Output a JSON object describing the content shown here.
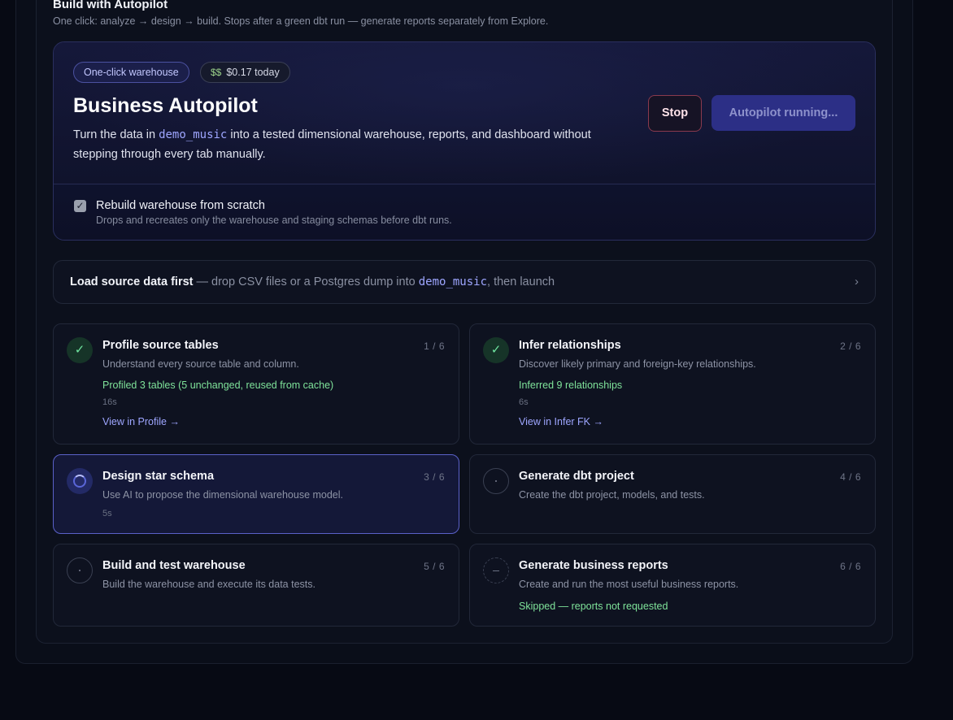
{
  "section": {
    "title": "Build with Autopilot",
    "subtitle": "One click: analyze → design → build. Stops after a green dbt run — generate reports separately from Explore."
  },
  "hero": {
    "mode_pill": "One-click warehouse",
    "cost_icon": "money-icon",
    "cost_pill": "$0.17 today",
    "title": "Business Autopilot",
    "desc_before": "Turn the data in ",
    "desc_code": "demo_music",
    "desc_after": " into a tested dimensional warehouse, reports, and dashboard without stepping through every tab manually.",
    "stop_label": "Stop",
    "run_label": "Autopilot running...",
    "rebuild": {
      "checked": true,
      "label": "Rebuild warehouse from scratch",
      "sub": "Drops and recreates only the warehouse and staging schemas before dbt runs."
    }
  },
  "load": {
    "strong": "Load source data first",
    "before": " — drop CSV files or a Postgres dump into ",
    "code": "demo_music",
    "after": ", then launch",
    "chevron": "›"
  },
  "steps": [
    {
      "status": "done",
      "title": "Profile source tables",
      "count": "1 / 6",
      "desc": "Understand every source table and column.",
      "result": "Profiled 3 tables (5 unchanged, reused from cache)",
      "time": "16s",
      "link": "View in Profile →"
    },
    {
      "status": "done",
      "title": "Infer relationships",
      "count": "2 / 6",
      "desc": "Discover likely primary and foreign-key relationships.",
      "result": "Inferred 9 relationships",
      "time": "6s",
      "link": "View in Infer FK →"
    },
    {
      "status": "running",
      "title": "Design star schema",
      "count": "3 / 6",
      "desc": "Use AI to propose the dimensional warehouse model.",
      "time": "5s"
    },
    {
      "status": "pending",
      "title": "Generate dbt project",
      "count": "4 / 6",
      "desc": "Create the dbt project, models, and tests."
    },
    {
      "status": "pending",
      "title": "Build and test warehouse",
      "count": "5 / 6",
      "desc": "Build the warehouse and execute its data tests."
    },
    {
      "status": "skipped",
      "title": "Generate business reports",
      "count": "6 / 6",
      "desc": "Create and run the most useful business reports.",
      "result": "Skipped — reports not requested"
    }
  ],
  "colors": {
    "accent": "#5b61c9",
    "success": "#7fe39a",
    "stop_border": "#8a3a4e",
    "run_button": "#2c2f86"
  }
}
